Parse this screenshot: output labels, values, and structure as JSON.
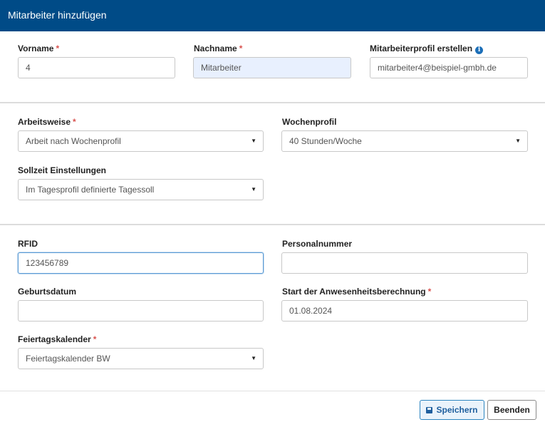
{
  "dialog": {
    "title": "Mitarbeiter hinzufügen"
  },
  "required_mark": "*",
  "section1": {
    "vorname": {
      "label": "Vorname",
      "value": "4"
    },
    "nachname": {
      "label": "Nachname",
      "value": "Mitarbeiter"
    },
    "profil": {
      "label": "Mitarbeiterprofil erstellen",
      "value": "mitarbeiter4@beispiel-gmbh.de",
      "info_icon": "i"
    }
  },
  "section2": {
    "arbeitsweise": {
      "label": "Arbeitsweise",
      "value": "Arbeit nach Wochenprofil"
    },
    "wochenprofil": {
      "label": "Wochenprofil",
      "value": "40 Stunden/Woche"
    },
    "sollzeit": {
      "label": "Sollzeit Einstellungen",
      "value": "Im Tagesprofil definierte Tagessoll"
    }
  },
  "section3": {
    "rfid": {
      "label": "RFID",
      "value": "123456789"
    },
    "personalnummer": {
      "label": "Personalnummer",
      "value": ""
    },
    "geburtsdatum": {
      "label": "Geburtsdatum",
      "value": ""
    },
    "start": {
      "label": "Start der Anwesenheitsberechnung",
      "value": "01.08.2024"
    },
    "feiertag": {
      "label": "Feiertagskalender",
      "value": "Feiertagskalender BW"
    }
  },
  "footer": {
    "save_label": "Speichern",
    "end_label": "Beenden"
  },
  "colors": {
    "header": "#004b87",
    "required": "#d9534f",
    "accent": "#2e86c1"
  },
  "icons": {
    "caret": "▼"
  }
}
